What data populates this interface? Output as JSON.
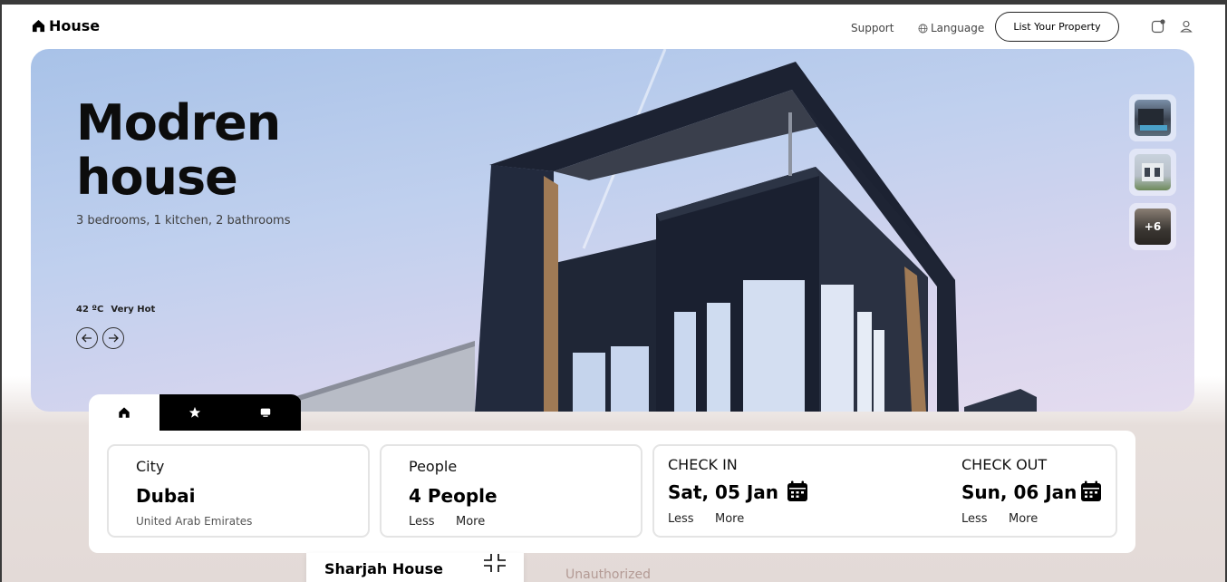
{
  "nav": {
    "brand": "House",
    "support": "Support",
    "language": "Language",
    "list_property": "List Your Property"
  },
  "hero": {
    "title_line1": "Modren",
    "title_line2": "house",
    "subtitle": "3 bedrooms, 1 kitchen, 2 bathrooms",
    "temperature": "42 ºC",
    "weather": "Very Hot",
    "more_photos": "+6"
  },
  "tabs": [
    {
      "icon": "home-icon",
      "active": true
    },
    {
      "icon": "star-icon",
      "active": false
    },
    {
      "icon": "tv-icon",
      "active": false
    }
  ],
  "search": {
    "city_label": "City",
    "city_value": "Dubai",
    "city_country": "United Arab Emirates",
    "people_label": "People",
    "people_value": "4 People",
    "less": "Less",
    "more": "More",
    "checkin_label": "CHECK IN",
    "checkin_value": "Sat, 05 Jan",
    "checkout_label": "CHECK OUT",
    "checkout_value": "Sun, 06 Jan"
  },
  "bottom": {
    "card_title": "Sharjah House",
    "status": "Unauthorized"
  }
}
